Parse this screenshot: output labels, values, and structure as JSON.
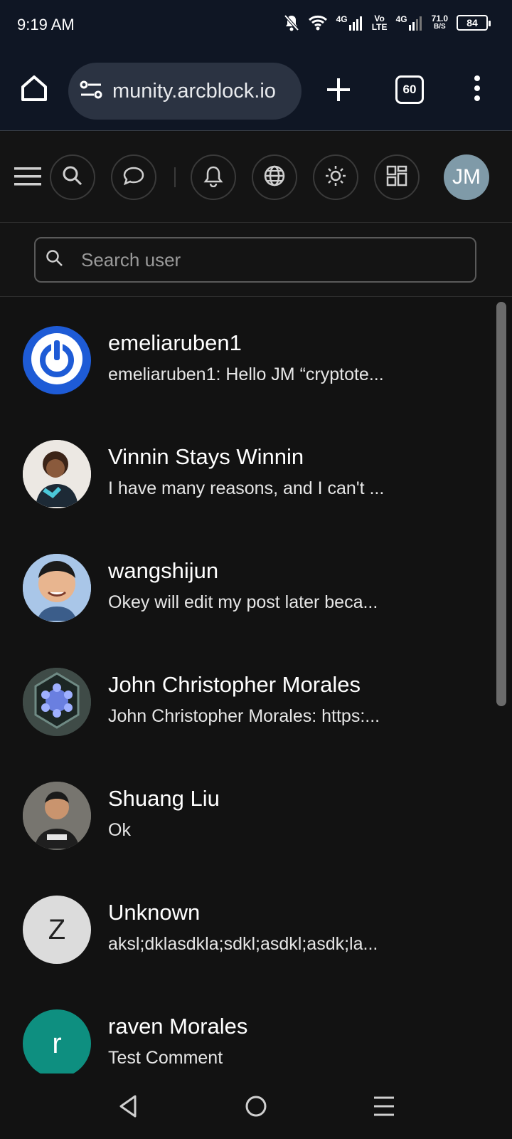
{
  "status_bar": {
    "time": "9:19 AM",
    "net1": "4G",
    "volte": "Vo LTE",
    "net2": "4G",
    "speed_value": "71.0",
    "speed_unit": "B/S",
    "battery": "84"
  },
  "browser": {
    "url": "munity.arcblock.io",
    "tab_count": "60"
  },
  "toolbar": {
    "avatar_initials": "JM",
    "avatar_color": "#7f9aa8"
  },
  "search": {
    "placeholder": "Search user"
  },
  "conversations": [
    {
      "name": "emeliaruben1",
      "message": "emeliaruben1: Hello JM “cryptote...",
      "avatar": "power-logo",
      "avatar_color": "#1e5bd6"
    },
    {
      "name": "Vinnin Stays Winnin",
      "message": "I have many reasons, and I can't ...",
      "avatar": "photo"
    },
    {
      "name": "wangshijun",
      "message": "Okey will edit my post later beca...",
      "avatar": "photo"
    },
    {
      "name": "John Christopher Morales",
      "message": "John Christopher Morales: https:...",
      "avatar": "badge"
    },
    {
      "name": "Shuang Liu",
      "message": "Ok",
      "avatar": "photo"
    },
    {
      "name": "Unknown",
      "message": "aksl;dklasdkla;sdkl;asdkl;asdk;la...",
      "avatar_letter": "Z",
      "avatar_color": "#dcdcdc"
    },
    {
      "name": "raven Morales",
      "message": "Test Comment",
      "avatar_letter": "r",
      "avatar_color": "#0e8f80"
    }
  ]
}
